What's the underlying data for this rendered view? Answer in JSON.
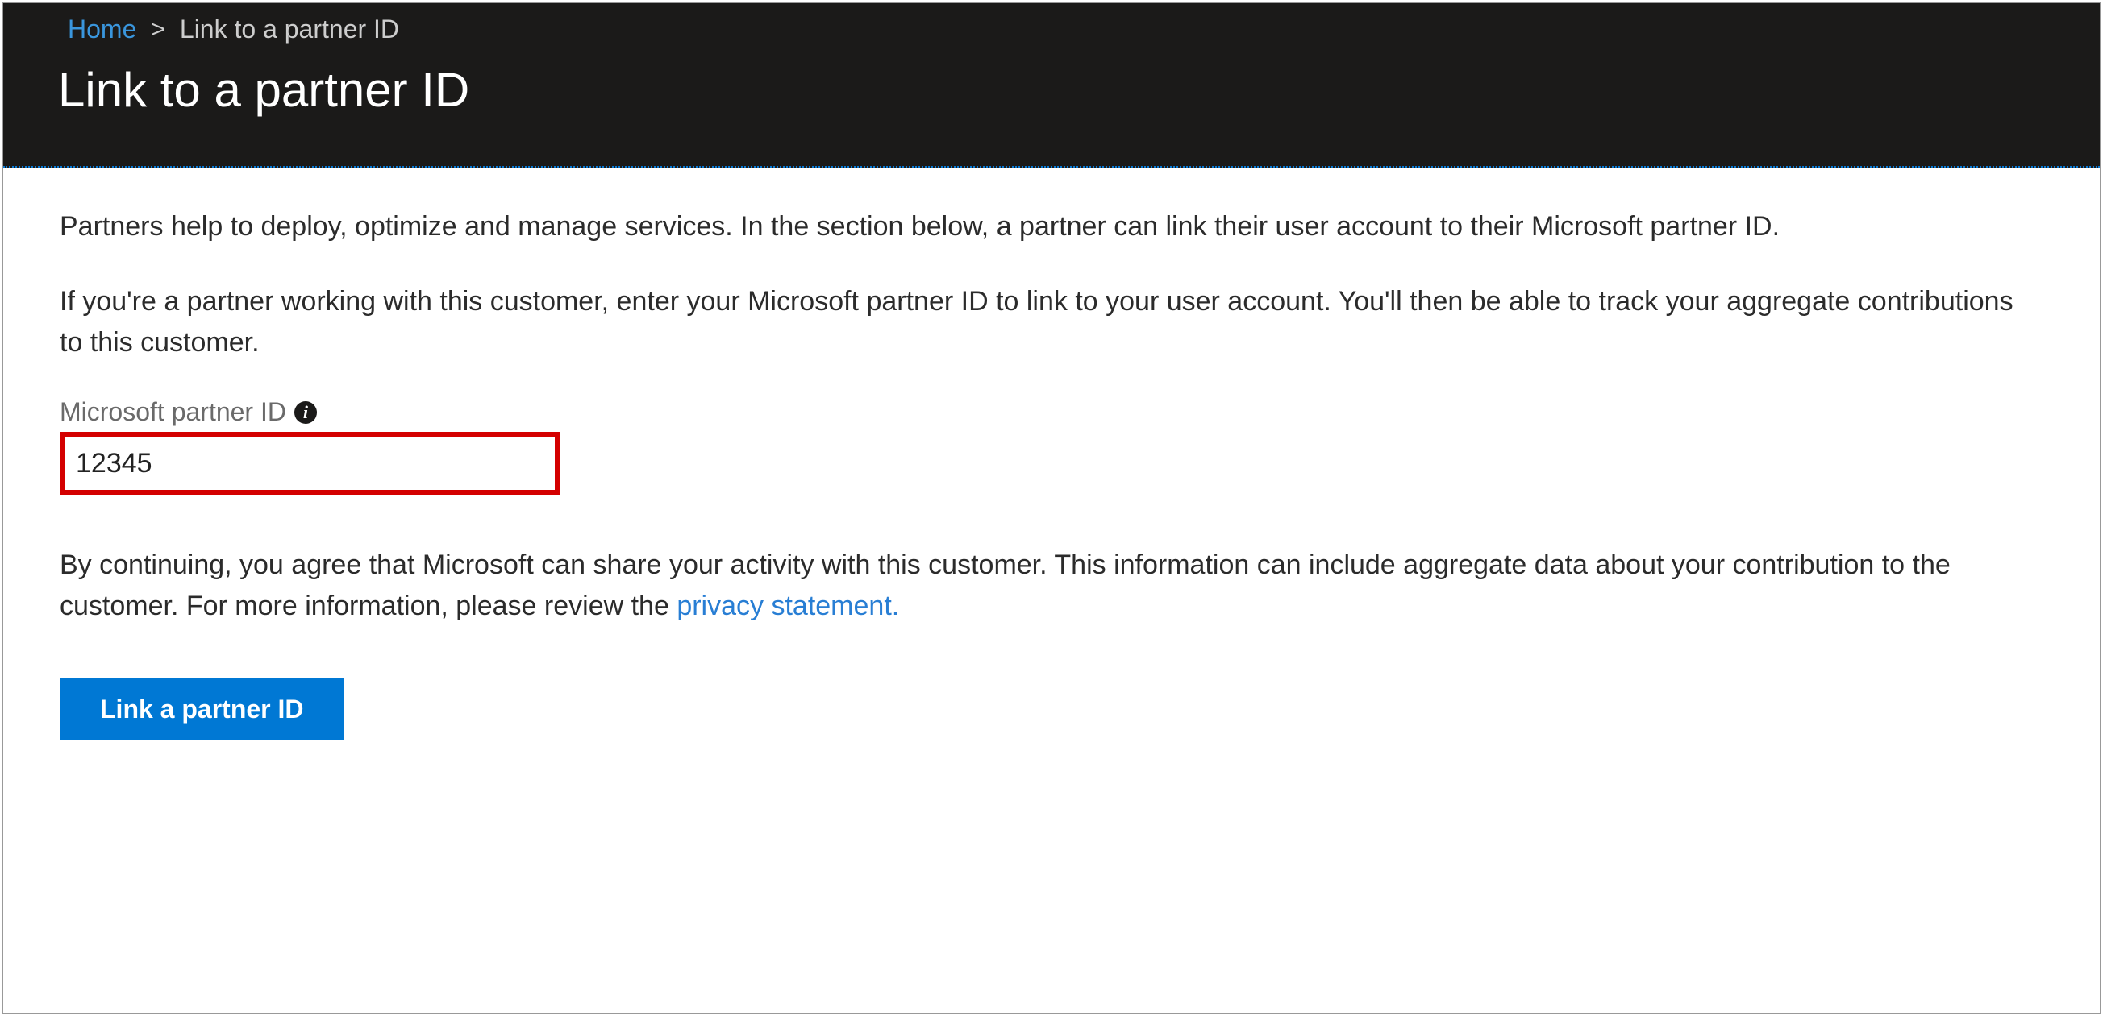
{
  "breadcrumb": {
    "home": "Home",
    "separator": ">",
    "current": "Link to a partner ID"
  },
  "header": {
    "title": "Link to a partner ID"
  },
  "body": {
    "intro": "Partners help to deploy, optimize and manage services. In the section below, a partner can link their user account to their Microsoft partner ID.",
    "instructions": "If you're a partner working with this customer, enter your Microsoft partner ID to link to your user account. You'll then be able to track your aggregate contributions to this customer.",
    "field_label": "Microsoft partner ID",
    "field_value": "12345",
    "agreement_pretext": "By continuing, you agree that Microsoft can share your activity with this customer. This information can include aggregate data about your contribution to the customer. For more information, please review the ",
    "privacy_link": "privacy statement.",
    "button_label": "Link a partner ID"
  }
}
